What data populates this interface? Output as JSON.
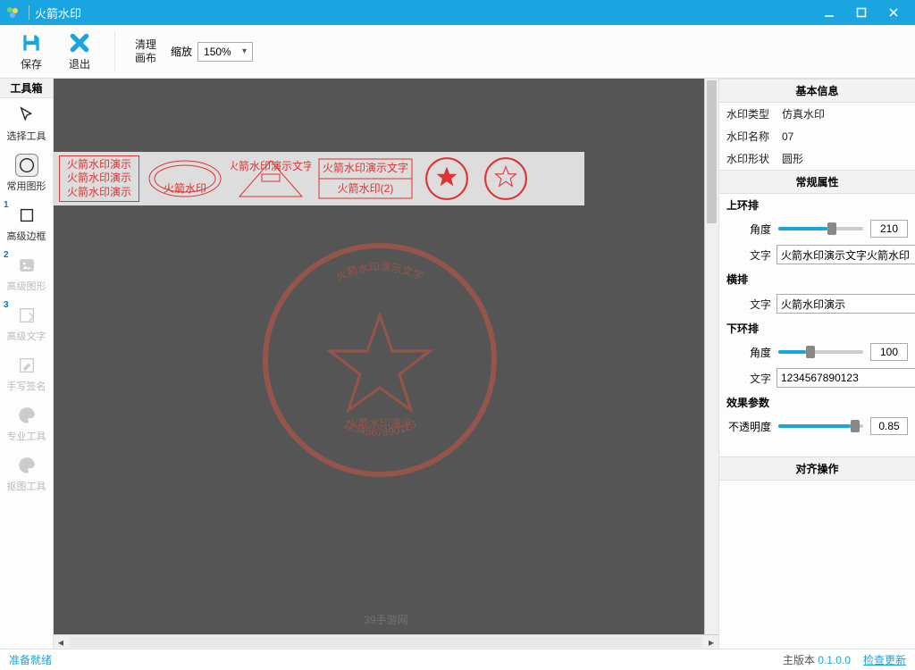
{
  "window": {
    "title": "火箭水印"
  },
  "ribbon": {
    "save": "保存",
    "exit": "退出",
    "clear": "清理\n画布",
    "zoom_label": "缩放",
    "zoom_value": "150%"
  },
  "toolbox": {
    "header": "工具箱",
    "items": [
      {
        "label": "选择工具",
        "icon": "cursor",
        "active": false,
        "disabled": false
      },
      {
        "label": "常用图形",
        "icon": "circle",
        "active": true,
        "disabled": false
      },
      {
        "label": "高级边框",
        "icon": "square",
        "active": false,
        "disabled": false,
        "badge": "1"
      },
      {
        "label": "高级图形",
        "icon": "image",
        "active": false,
        "disabled": true,
        "badge": "2"
      },
      {
        "label": "高级文字",
        "icon": "text-edit",
        "active": false,
        "disabled": true,
        "badge": "3"
      },
      {
        "label": "手写签名",
        "icon": "pencil-box",
        "active": false,
        "disabled": true
      },
      {
        "label": "专业工具",
        "icon": "palette",
        "active": false,
        "disabled": true
      },
      {
        "label": "抠图工具",
        "icon": "palette",
        "active": false,
        "disabled": true
      }
    ]
  },
  "canvas": {
    "stamp_top_text": "火箭水印演示文字",
    "stamp_mid_text": "火箭水印演示",
    "stamp_bottom_text": "1234567890123",
    "gallery": {
      "item1_l1": "火箭水印演示",
      "item1_l2": "火箭水印演示",
      "item1_l3": "火箭水印演示",
      "item4_top": "火箭水印演示文字",
      "item4_bot": "火箭水印(2)",
      "item3_text": "火箭水印演示文字"
    },
    "watermark": "39手游网"
  },
  "props": {
    "basic_header": "基本信息",
    "type_k": "水印类型",
    "type_v": "仿真水印",
    "name_k": "水印名称",
    "name_v": "07",
    "shape_k": "水印形状",
    "shape_v": "圆形",
    "general_header": "常规属性",
    "top_ring": "上环排",
    "angle": "角度",
    "text": "文字",
    "top_angle": "210",
    "top_text": "火箭水印演示文字火箭水印",
    "horiz": "横排",
    "horiz_text": "火箭水印演示",
    "bottom_ring": "下环排",
    "bottom_angle": "100",
    "bottom_text": "1234567890123",
    "fx_header": "效果参数",
    "opacity": "不透明度",
    "opacity_val": "0.85",
    "align_header": "对齐操作"
  },
  "status": {
    "ready": "准备就绪",
    "ver_label": "主版本",
    "ver_num": "0.1.0.0",
    "update": "检查更新"
  }
}
